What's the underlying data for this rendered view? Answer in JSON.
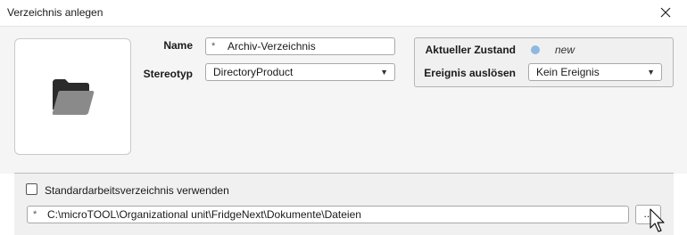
{
  "window": {
    "title": "Verzeichnis anlegen"
  },
  "form": {
    "name_label": "Name",
    "name_required": "*",
    "name_value": "Archiv-Verzeichnis",
    "stereotype_label": "Stereotyp",
    "stereotype_value": "DirectoryProduct"
  },
  "state": {
    "current_label": "Aktueller Zustand",
    "current_value": "new",
    "event_label": "Ereignis auslösen",
    "event_value": "Kein Ereignis"
  },
  "directory": {
    "checkbox_label": "Standardarbeitsverzeichnis verwenden",
    "checkbox_checked": false,
    "path_required": "*",
    "path_value": "C:\\microTOOL\\Organizational unit\\FridgeNext\\Dokumente\\Dateien",
    "browse_label": "..."
  },
  "icons": {
    "close": "close-icon",
    "folder": "folder-icon",
    "dropdown": "chevron-down-icon",
    "cursor": "mouse-pointer-icon"
  },
  "colors": {
    "state_dot": "#8fb8e0"
  }
}
